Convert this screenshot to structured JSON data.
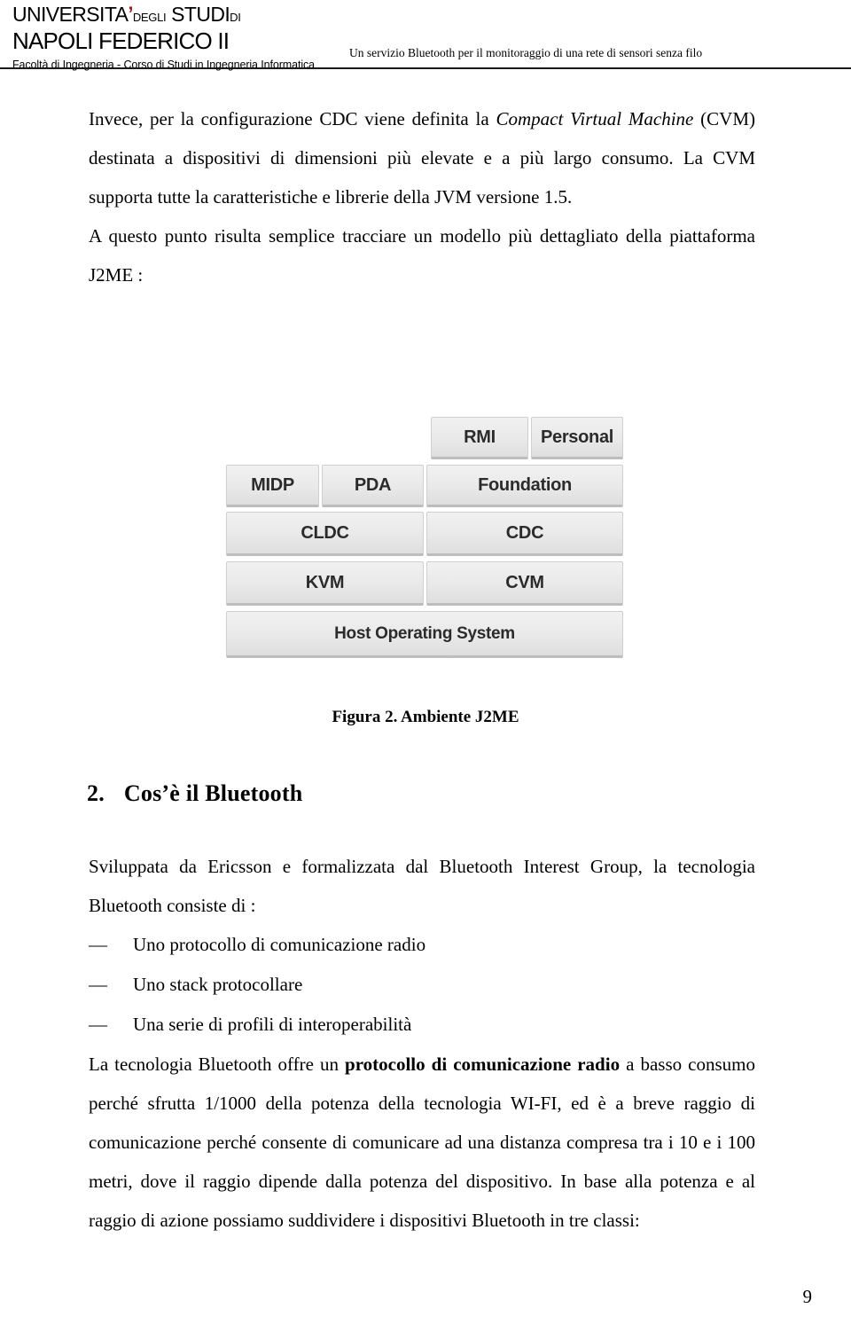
{
  "header": {
    "university_line1_main": "UNIVERSITA",
    "university_line1_apostrophe": "’",
    "university_line1_small": "DEGLI",
    "university_line1_studi": "STUDI",
    "university_line1_di": "DI",
    "university_line2": "NAPOLI FEDERICO II",
    "faculty": "Facoltà di Ingegneria - Corso di Studi in Ingegneria Informatica",
    "thesis_title": "Un servizio Bluetooth per il monitoraggio di una rete di sensori senza filo"
  },
  "paragraphs": {
    "p1_a": "Invece, per la configurazione CDC viene definita la ",
    "p1_italic": "Compact Virtual Machine",
    "p1_b": " (CVM) destinata a dispositivi di dimensioni più elevate e a più largo consumo. La CVM supporta tutte la caratteristiche e librerie della JVM versione 1.5.",
    "p2": "A questo punto risulta semplice tracciare un modello più dettagliato della piattaforma J2ME :",
    "p3": "Sviluppata da Ericsson e formalizzata dal Bluetooth Interest Group, la tecnologia Bluetooth consiste di :",
    "p4_a": "La tecnologia  Bluetooth offre un ",
    "p4_bold": "protocollo di comunicazione radio",
    "p4_b": " a basso consumo perché sfrutta 1/1000 della potenza della tecnologia WI-FI, ed è a breve raggio di comunicazione perché consente di comunicare ad una distanza compresa tra i 10 e i 100 metri, dove il raggio dipende dalla potenza del dispositivo. In base alla potenza e al raggio di azione possiamo suddividere i dispositivi Bluetooth in tre classi:"
  },
  "figure": {
    "caption": "Figura 2. Ambiente J2ME",
    "boxes": {
      "rmi": "RMI",
      "personal": "Personal",
      "midp": "MIDP",
      "pda": "PDA",
      "foundation": "Foundation",
      "cldc": "CLDC",
      "cdc": "CDC",
      "kvm": "KVM",
      "cvm": "CVM",
      "host_os": "Host Operating System"
    }
  },
  "section": {
    "number": "2.",
    "title": "Cos’è il Bluetooth"
  },
  "list": {
    "marker": "—",
    "items": [
      "Uno protocollo di comunicazione radio",
      "Uno stack protocollare",
      "Una serie di profili di interoperabilità"
    ]
  },
  "footer": {
    "page_number": "9"
  },
  "colors": {
    "apostrophe_red": "#9e1b1b",
    "rule_black": "#1a1a1a",
    "box_fill": "#e9e9e9"
  }
}
